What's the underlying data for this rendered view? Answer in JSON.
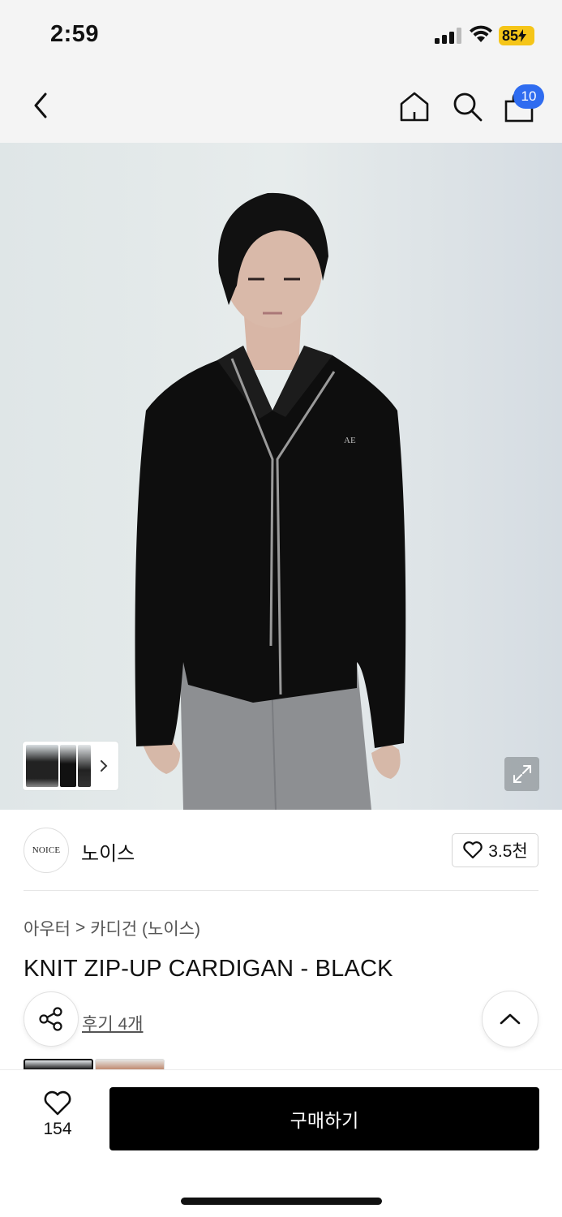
{
  "status_bar": {
    "time": "2:59",
    "battery": "85"
  },
  "nav": {
    "cart_badge": "10"
  },
  "brand": {
    "logo_text": "NOICE",
    "name": "노이스",
    "like_count": "3.5천"
  },
  "breadcrumb": {
    "level1": "아우터",
    "separator": ">",
    "level2": "카디건 (노이스)"
  },
  "product": {
    "title": "KNIT ZIP-UP CARDIGAN - BLACK",
    "review_link": "후기 4개"
  },
  "bottom_bar": {
    "wish_count": "154",
    "buy_label": "구매하기"
  },
  "colors": {
    "accent_badge": "#2f6cf0",
    "buy_button": "#000000",
    "battery": "#f5c518"
  },
  "icons": [
    "back-icon",
    "home-icon",
    "search-icon",
    "cart-icon",
    "expand-icon",
    "heart-icon",
    "share-icon",
    "chevron-up-icon",
    "chevron-right-icon"
  ]
}
